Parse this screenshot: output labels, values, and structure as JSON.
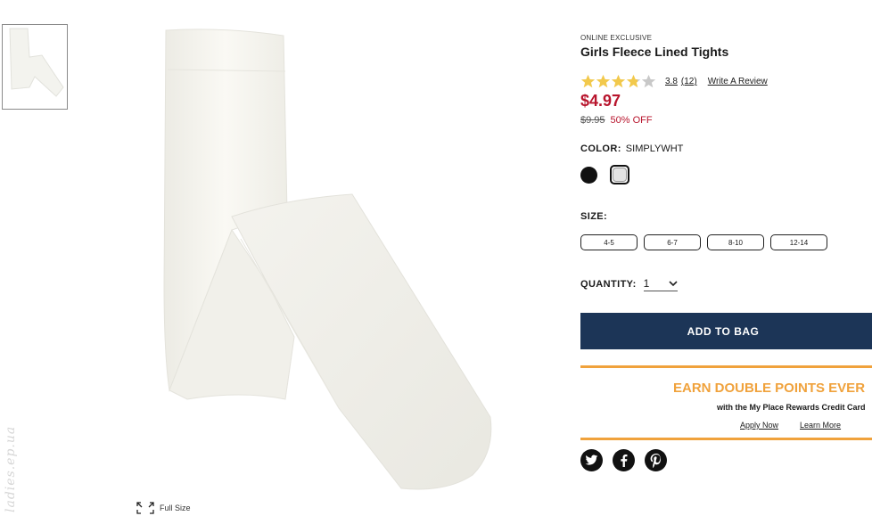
{
  "product": {
    "badge": "ONLINE EXCLUSIVE",
    "title": "Girls Fleece Lined Tights",
    "rating_value": "3.8",
    "rating_stars": 3.8,
    "review_count": "(12)",
    "write_review": "Write A Review",
    "price": "$4.97",
    "original_price": "$9.95",
    "discount": "50% OFF"
  },
  "color": {
    "label": "COLOR:",
    "selected": "SIMPLYWHT",
    "swatches": [
      "black",
      "simplywht"
    ]
  },
  "size": {
    "label": "SIZE:",
    "options": [
      "4-5",
      "6-7",
      "8-10",
      "12-14"
    ]
  },
  "quantity": {
    "label": "QUANTITY:",
    "value": "1"
  },
  "add_to_bag": "ADD TO BAG",
  "promo": {
    "headline": "EARN DOUBLE POINTS EVER",
    "subtext": "with the My Place Rewards Credit Card",
    "apply": "Apply Now",
    "learn": "Learn More"
  },
  "gallery": {
    "full_size": "Full Size"
  },
  "watermark": "ladies.ep.ua",
  "colors": {
    "price_red": "#b8152d",
    "button_navy": "#1c3557",
    "promo_orange": "#f0a23c",
    "star_gold": "#f2c94c"
  },
  "icons": {
    "social": [
      "twitter-icon",
      "facebook-icon",
      "pinterest-icon"
    ]
  }
}
